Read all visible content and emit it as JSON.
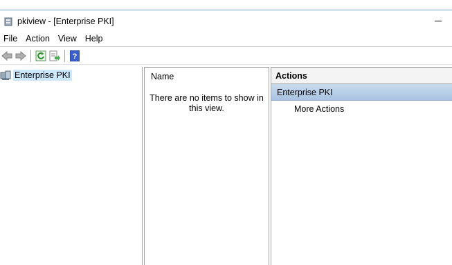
{
  "window": {
    "title": "pkiview - [Enterprise PKI]"
  },
  "menu": {
    "items": [
      "File",
      "Action",
      "View",
      "Help"
    ]
  },
  "toolbar": {
    "buttons": [
      "back-arrow-icon",
      "forward-arrow-icon",
      "refresh-icon",
      "export-list-icon",
      "help-icon"
    ]
  },
  "tree": {
    "root_label": "Enterprise PKI"
  },
  "center": {
    "column_header": "Name",
    "empty_message": "There are no items to show in this view."
  },
  "actions": {
    "header": "Actions",
    "section_title": "Enterprise PKI",
    "link": "More Actions"
  },
  "colors": {
    "selection": "#cce8ff",
    "section_band": "#b6cde7",
    "border": "#a0a0a0"
  }
}
